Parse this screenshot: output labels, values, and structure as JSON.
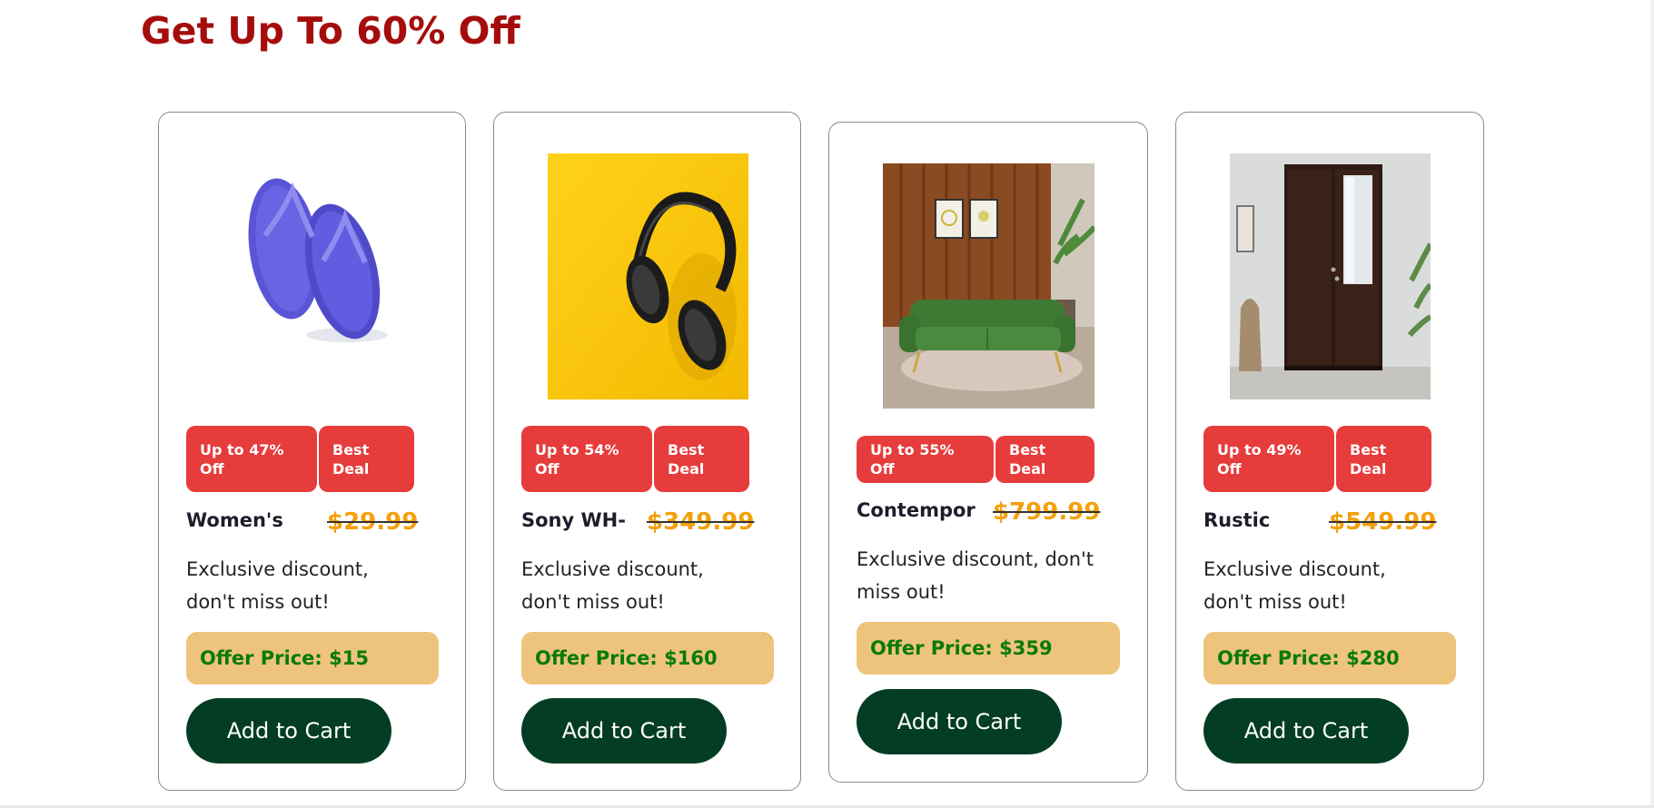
{
  "header": {
    "title": "Get Up To 60% Off"
  },
  "products": [
    {
      "name": "Women's",
      "old_price": "$29.99",
      "discount_badge": "Up to 47% Off",
      "deal_badge": "Best Deal",
      "description": "Exclusive discount, don't miss out!",
      "offer_price": "Offer Price: $15",
      "cart_label": "Add to Cart",
      "icon": "flip-flops-image"
    },
    {
      "name": "Sony WH-",
      "old_price": "$349.99",
      "discount_badge": "Up to 54% Off",
      "deal_badge": "Best Deal",
      "description": "Exclusive discount, don't miss out!",
      "offer_price": "Offer Price: $160",
      "cart_label": "Add to Cart",
      "icon": "headphones-image"
    },
    {
      "name": "Contempor",
      "old_price": "$799.99",
      "discount_badge": "Up to 55% Off",
      "deal_badge": "Best Deal",
      "description": "Exclusive discount, don't miss out!",
      "offer_price": "Offer Price: $359",
      "cart_label": "Add to Cart",
      "icon": "sofa-image"
    },
    {
      "name": "Rustic",
      "old_price": "$549.99",
      "discount_badge": "Up to 49% Off",
      "deal_badge": "Best Deal",
      "description": "Exclusive discount, don't miss out!",
      "offer_price": "Offer Price: $280",
      "cart_label": "Add to Cart",
      "icon": "wardrobe-image"
    }
  ],
  "colors": {
    "heading": "#a50d0d",
    "badge": "#e63c3c",
    "old_price": "#f5a00a",
    "offer_bg": "#eec47c",
    "offer_text": "#0a7a0a",
    "button": "#033d23"
  }
}
